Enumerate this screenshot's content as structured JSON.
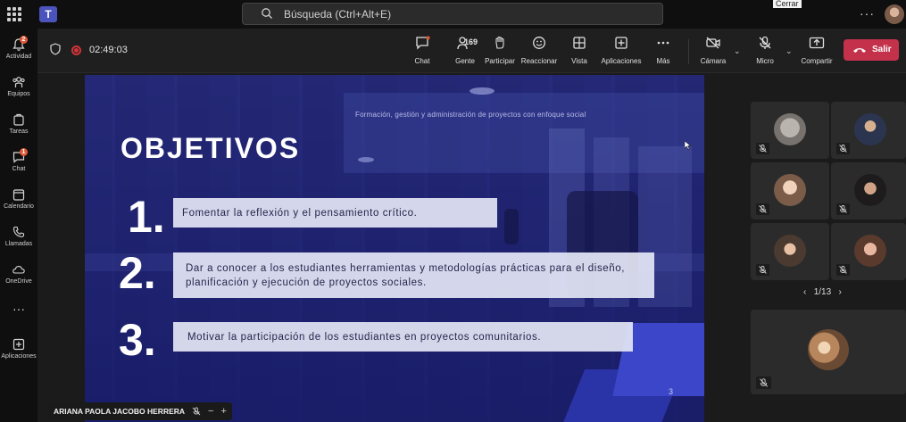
{
  "titlebar": {
    "search_placeholder": "Búsqueda (Ctrl+Alt+E)",
    "tooltip": "Cerrar",
    "teams_logo": "T"
  },
  "rail": {
    "items": [
      {
        "label": "Actividad",
        "badge": "2",
        "icon": "bell-icon"
      },
      {
        "label": "Equipos",
        "badge": "",
        "icon": "teams-icon"
      },
      {
        "label": "Tareas",
        "badge": "",
        "icon": "tasks-icon"
      },
      {
        "label": "Chat",
        "badge": "1",
        "icon": "chat-icon"
      },
      {
        "label": "Calendario",
        "badge": "",
        "icon": "calendar-icon"
      },
      {
        "label": "Llamadas",
        "badge": "",
        "icon": "phone-icon"
      },
      {
        "label": "OneDrive",
        "badge": "",
        "icon": "cloud-icon"
      },
      {
        "label": "Aplicaciones",
        "badge": "",
        "icon": "apps-icon"
      }
    ]
  },
  "toolbar": {
    "timer": "02:49:03",
    "chat": "Chat",
    "people": "Gente",
    "people_count": "169",
    "raise": "Participar",
    "react": "Reaccionar",
    "view": "Vista",
    "apps": "Aplicaciones",
    "more": "Más",
    "camera": "Cámara",
    "mic": "Micro",
    "share": "Compartir",
    "leave": "Salir"
  },
  "slide": {
    "subtitle": "Formación, gestión y administración de proyectos con enfoque social",
    "title": "OBJETIVOS",
    "objectives": [
      {
        "num": "1.",
        "text": "Fomentar la reflexión y el pensamiento crítico."
      },
      {
        "num": "2.",
        "text": "Dar a conocer a los estudiantes herramientas y metodologías prácticas para el diseño, planificación y ejecución de proyectos sociales."
      },
      {
        "num": "3.",
        "text": "Motivar la participación de los estudiantes en proyectos comunitarios."
      }
    ],
    "page": "3"
  },
  "presenter": {
    "name": "ARIANA PAOLA JACOBO HERRERA",
    "minus": "−",
    "plus": "+"
  },
  "participants": {
    "pager": "1/13",
    "prev": "‹",
    "next": "›"
  },
  "colors": {
    "leave_red": "#c4314b",
    "slide_blue": "#2b3072",
    "badge": "#e05a3a"
  }
}
